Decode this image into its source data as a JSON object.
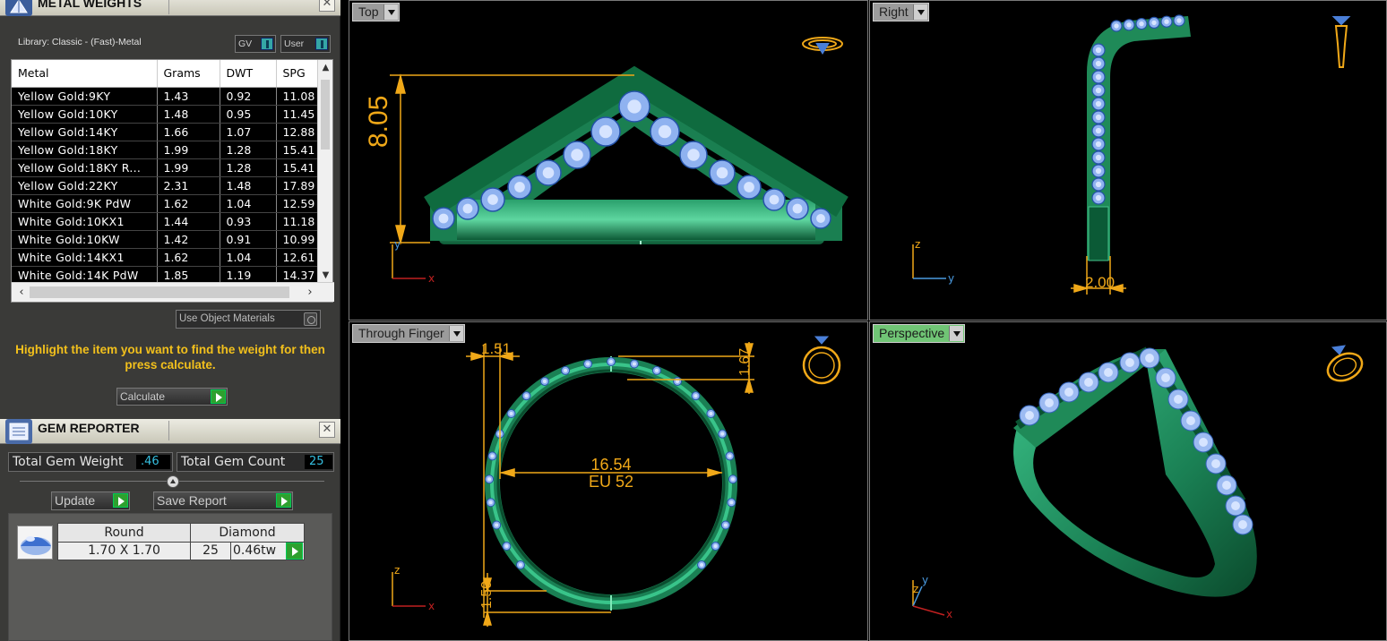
{
  "metal_weights": {
    "title": "METAL WEIGHTS",
    "library_label": "Library: Classic - (Fast)-Metal",
    "gv_label": "GV",
    "user_label": "User",
    "columns": [
      "Metal",
      "Grams",
      "DWT",
      "SPG"
    ],
    "rows": [
      [
        "Yellow Gold:9KY",
        "1.43",
        "0.92",
        "11.08"
      ],
      [
        "Yellow Gold:10KY",
        "1.48",
        "0.95",
        "11.45"
      ],
      [
        "Yellow Gold:14KY",
        "1.66",
        "1.07",
        "12.88"
      ],
      [
        "Yellow Gold:18KY",
        "1.99",
        "1.28",
        "15.41"
      ],
      [
        "Yellow Gold:18KY R...",
        "1.99",
        "1.28",
        "15.41"
      ],
      [
        "Yellow Gold:22KY",
        "2.31",
        "1.48",
        "17.89"
      ],
      [
        "White Gold:9K PdW",
        "1.62",
        "1.04",
        "12.59"
      ],
      [
        "White Gold:10KX1",
        "1.44",
        "0.93",
        "11.18"
      ],
      [
        "White Gold:10KW",
        "1.42",
        "0.91",
        "10.99"
      ],
      [
        "White Gold:14KX1",
        "1.62",
        "1.04",
        "12.61"
      ],
      [
        "White Gold:14K PdW",
        "1.85",
        "1.19",
        "14.37"
      ]
    ],
    "use_object_materials": "Use Object Materials",
    "instruction": "Highlight the item you want to find the weight for then press calculate.",
    "calculate_label": "Calculate"
  },
  "gem_reporter": {
    "title": "GEM REPORTER",
    "total_gem_weight_label": "Total Gem Weight",
    "total_gem_weight_value": ".46",
    "total_gem_count_label": "Total Gem Count",
    "total_gem_count_value": "25",
    "update_label": "Update",
    "save_report_label": "Save Report",
    "gem": {
      "shape": "Round",
      "material": "Diamond",
      "size": "1.70 X 1.70",
      "count": "25",
      "weight": "0.46tw"
    }
  },
  "viewports": {
    "top": {
      "label": "Top",
      "dimension": "8.05",
      "axis_y": "y",
      "axis_x": "x"
    },
    "right": {
      "label": "Right",
      "dimension": "2.00",
      "axis_z": "z",
      "axis_y": "y"
    },
    "through_finger": {
      "label": "Through Finger",
      "dim_left": "1.51",
      "dim_right": "1.67",
      "dim_diameter": "16.54",
      "dim_size": "EU 52",
      "dim_bottom": "1.50",
      "axis_z": "z",
      "axis_x": "x"
    },
    "perspective": {
      "label": "Perspective",
      "axis_z": "z",
      "axis_y": "y",
      "axis_x": "x",
      "active": true
    }
  },
  "colors": {
    "dimension": "#f0a818",
    "metal": "#1d8c5c",
    "gem": "#8fb2f0",
    "instruction_text": "#f2c01c",
    "active_tab": "#70c575"
  },
  "icons": [
    "metal-weights-icon",
    "gem-reporter-icon",
    "close-icon",
    "dropdown-arrow-icon",
    "play-icon",
    "diamond-thumbnail-icon",
    "ring-orientation-icon"
  ]
}
